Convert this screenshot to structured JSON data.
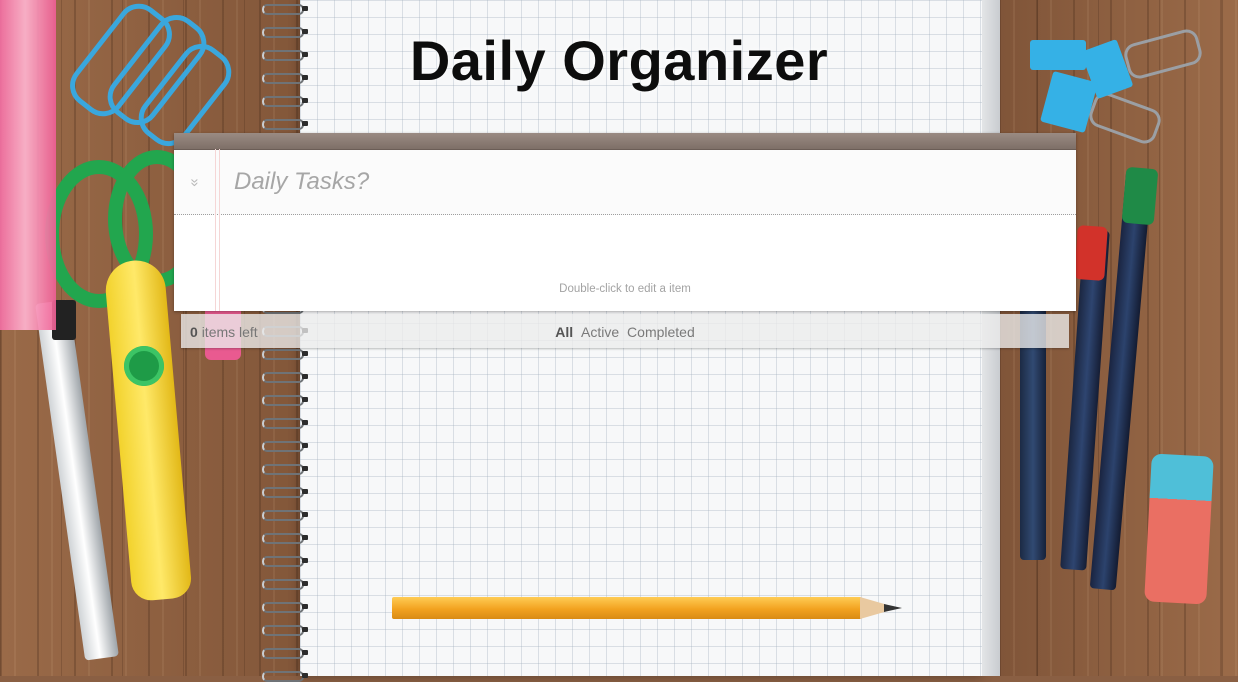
{
  "app": {
    "title": "Daily Organizer"
  },
  "todo": {
    "toggle_all_icon": "double-chevron-down-icon",
    "toggle_all_glyph": "»",
    "new_todo_placeholder": "Daily Tasks?",
    "new_todo_value": "",
    "hint": "Double-click to edit a item"
  },
  "footer": {
    "count": "0",
    "count_suffix": "items left",
    "filters": [
      {
        "label": "All",
        "selected": true
      },
      {
        "label": "Active",
        "selected": false
      },
      {
        "label": "Completed",
        "selected": false
      }
    ]
  },
  "colors": {
    "topbar": "#8a7b73",
    "title": "#0d0d0d"
  }
}
